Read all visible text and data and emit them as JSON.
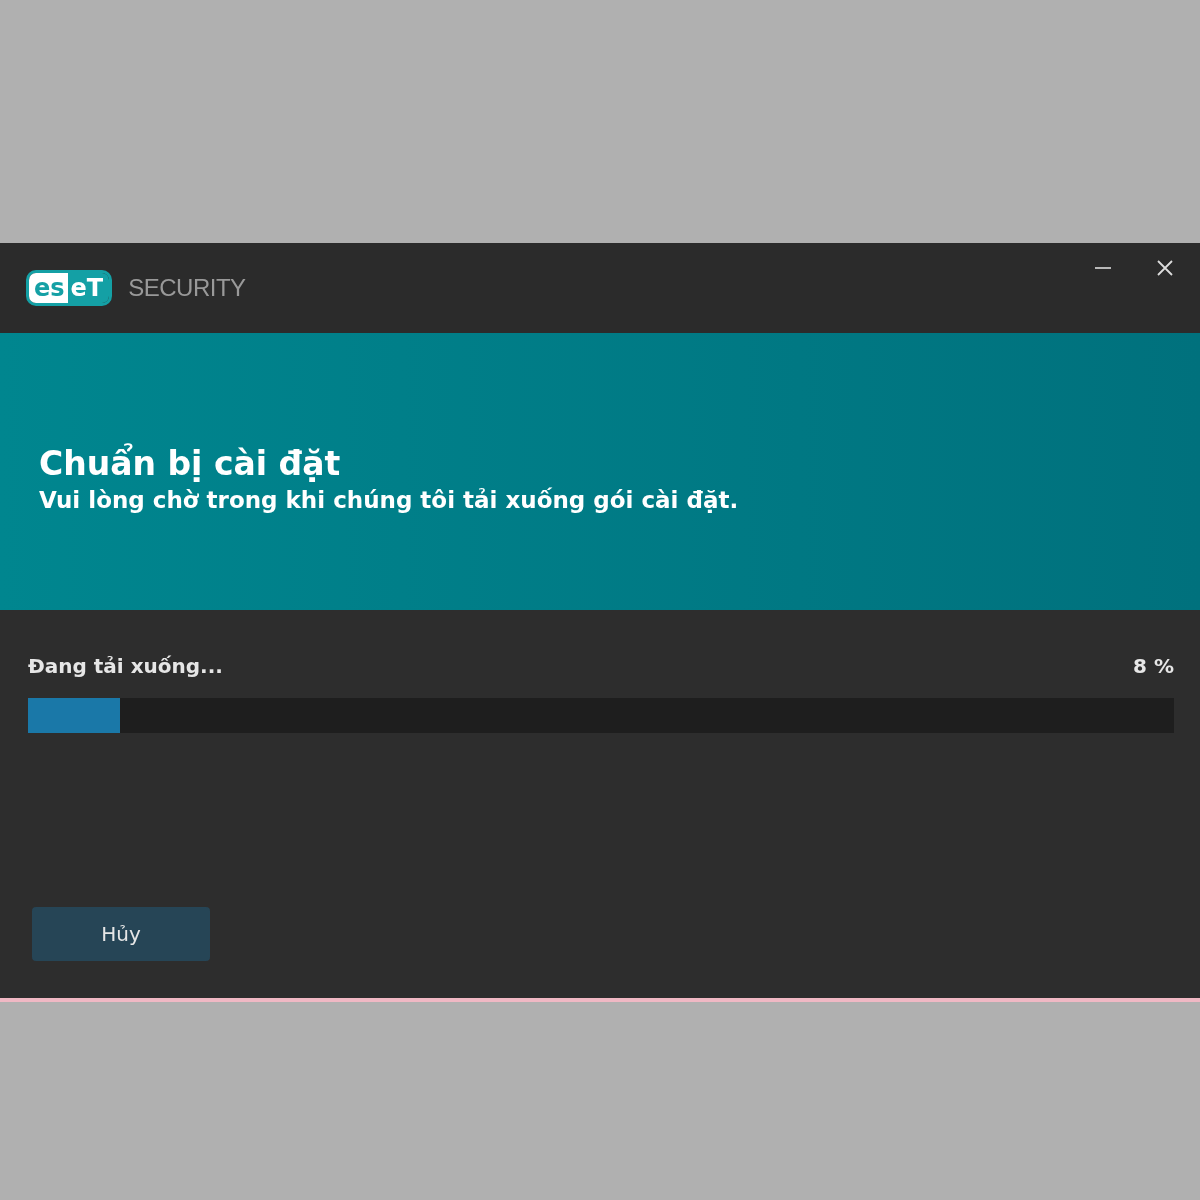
{
  "window": {
    "logo": [
      "es",
      "eT"
    ],
    "product": "SECURITY",
    "controls": [
      {
        "kind": "minimize"
      },
      {
        "kind": "close"
      }
    ]
  },
  "banner": {
    "title": "Chuẩn bị cài đặt",
    "subtitle": "Vui lòng chờ trong khi chúng tôi tải xuống gói cài đặt."
  },
  "progress": {
    "label": "Đang tải xuống...",
    "reading": "8 %",
    "level": 0.08
  },
  "buttons": [
    "Hủy"
  ]
}
